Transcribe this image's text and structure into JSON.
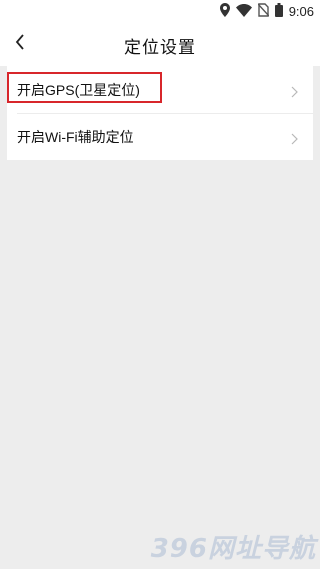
{
  "status_bar": {
    "time": "9:06",
    "icons": [
      "location-icon",
      "wifi-icon",
      "no-sim-icon",
      "battery-icon"
    ]
  },
  "header": {
    "title": "定位设置",
    "back_icon": "chevron-left-icon"
  },
  "settings": {
    "items": [
      {
        "label": "开启GPS(卫星定位)",
        "icon": "chevron-right-icon"
      },
      {
        "label": "开启Wi-Fi辅助定位",
        "icon": "chevron-right-icon"
      }
    ]
  },
  "watermark": {
    "text": "396网址导航"
  },
  "colors": {
    "background": "#ededed",
    "card": "#ffffff",
    "highlight": "#d8262b",
    "chevron": "#b8b8b8"
  }
}
